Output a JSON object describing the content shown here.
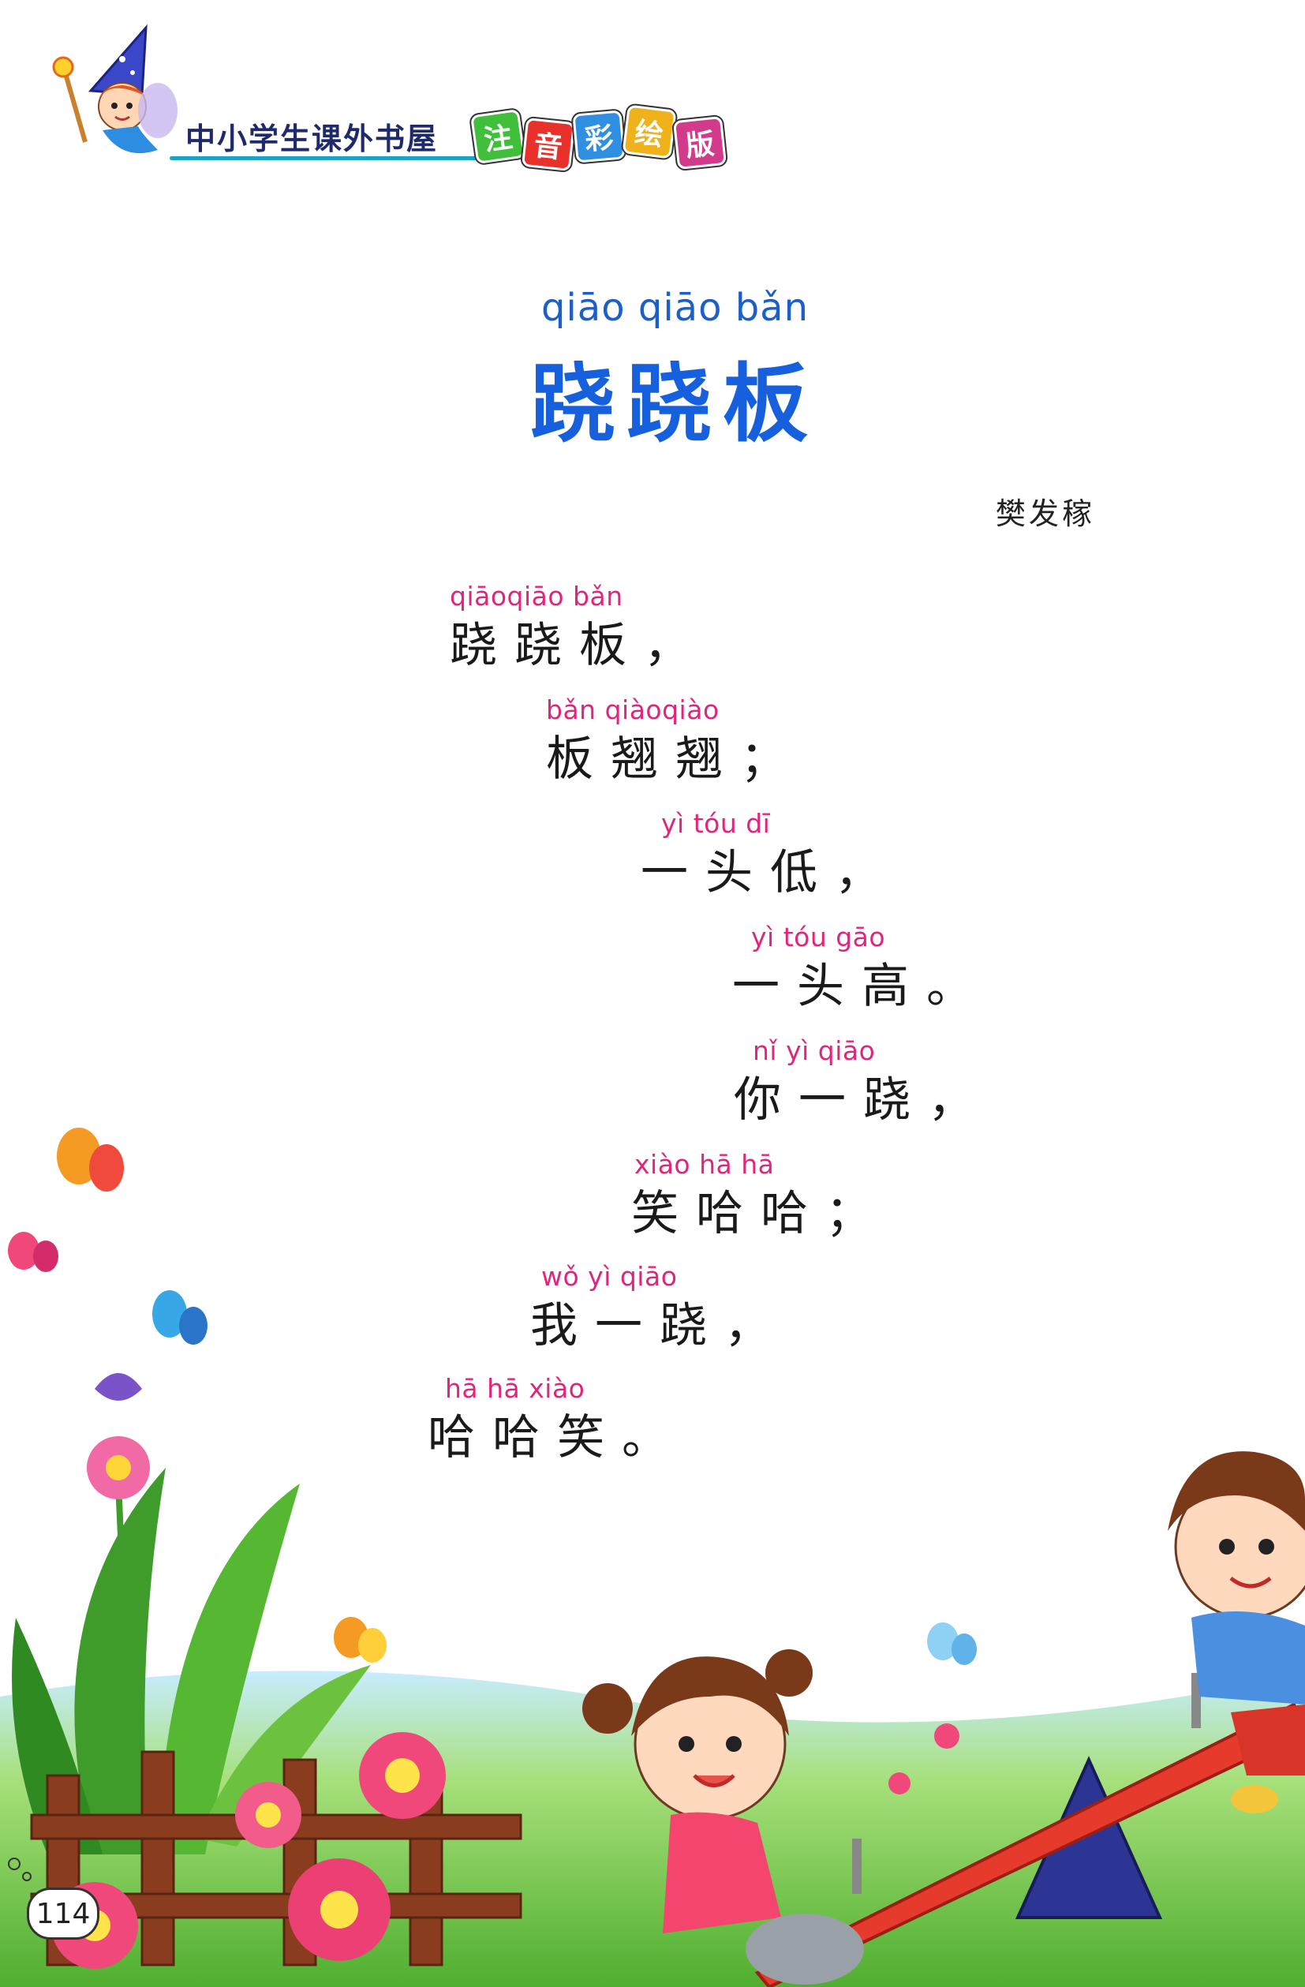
{
  "header": {
    "series_title": "中小学生课外书屋",
    "edition_badges": [
      "注",
      "音",
      "彩",
      "绘",
      "版"
    ]
  },
  "title": {
    "pinyin": "qiāo qiāo bǎn",
    "hanzi": "跷跷板"
  },
  "author": "樊发稼",
  "poem": [
    {
      "pinyin": "qiāoqiāo bǎn",
      "hanzi": "跷跷板，"
    },
    {
      "pinyin": "bǎn qiàoqiào",
      "hanzi": "板翘翘；"
    },
    {
      "pinyin": "yì  tóu  dī",
      "hanzi": "一头低，"
    },
    {
      "pinyin": "yì  tóu gāo",
      "hanzi": "一头高。"
    },
    {
      "pinyin": "nǐ   yì  qiāo",
      "hanzi": "你一跷，"
    },
    {
      "pinyin": "xiào hā   hā",
      "hanzi": "笑哈哈；"
    },
    {
      "pinyin": "wǒ  yì  qiāo",
      "hanzi": "我一跷，"
    },
    {
      "pinyin": "hā   hā  xiào",
      "hanzi": "哈哈笑。"
    }
  ],
  "page_number": "114",
  "colors": {
    "title_blue": "#1660dd",
    "pinyin_pink": "#e0267a",
    "seesaw_red": "#e53a2c",
    "grass_green": "#5fbf3c"
  },
  "icons": [
    "fairy-icon",
    "butterfly-icon",
    "flower-icon",
    "fence-icon",
    "boy-icon",
    "girl-icon",
    "seesaw-icon"
  ]
}
